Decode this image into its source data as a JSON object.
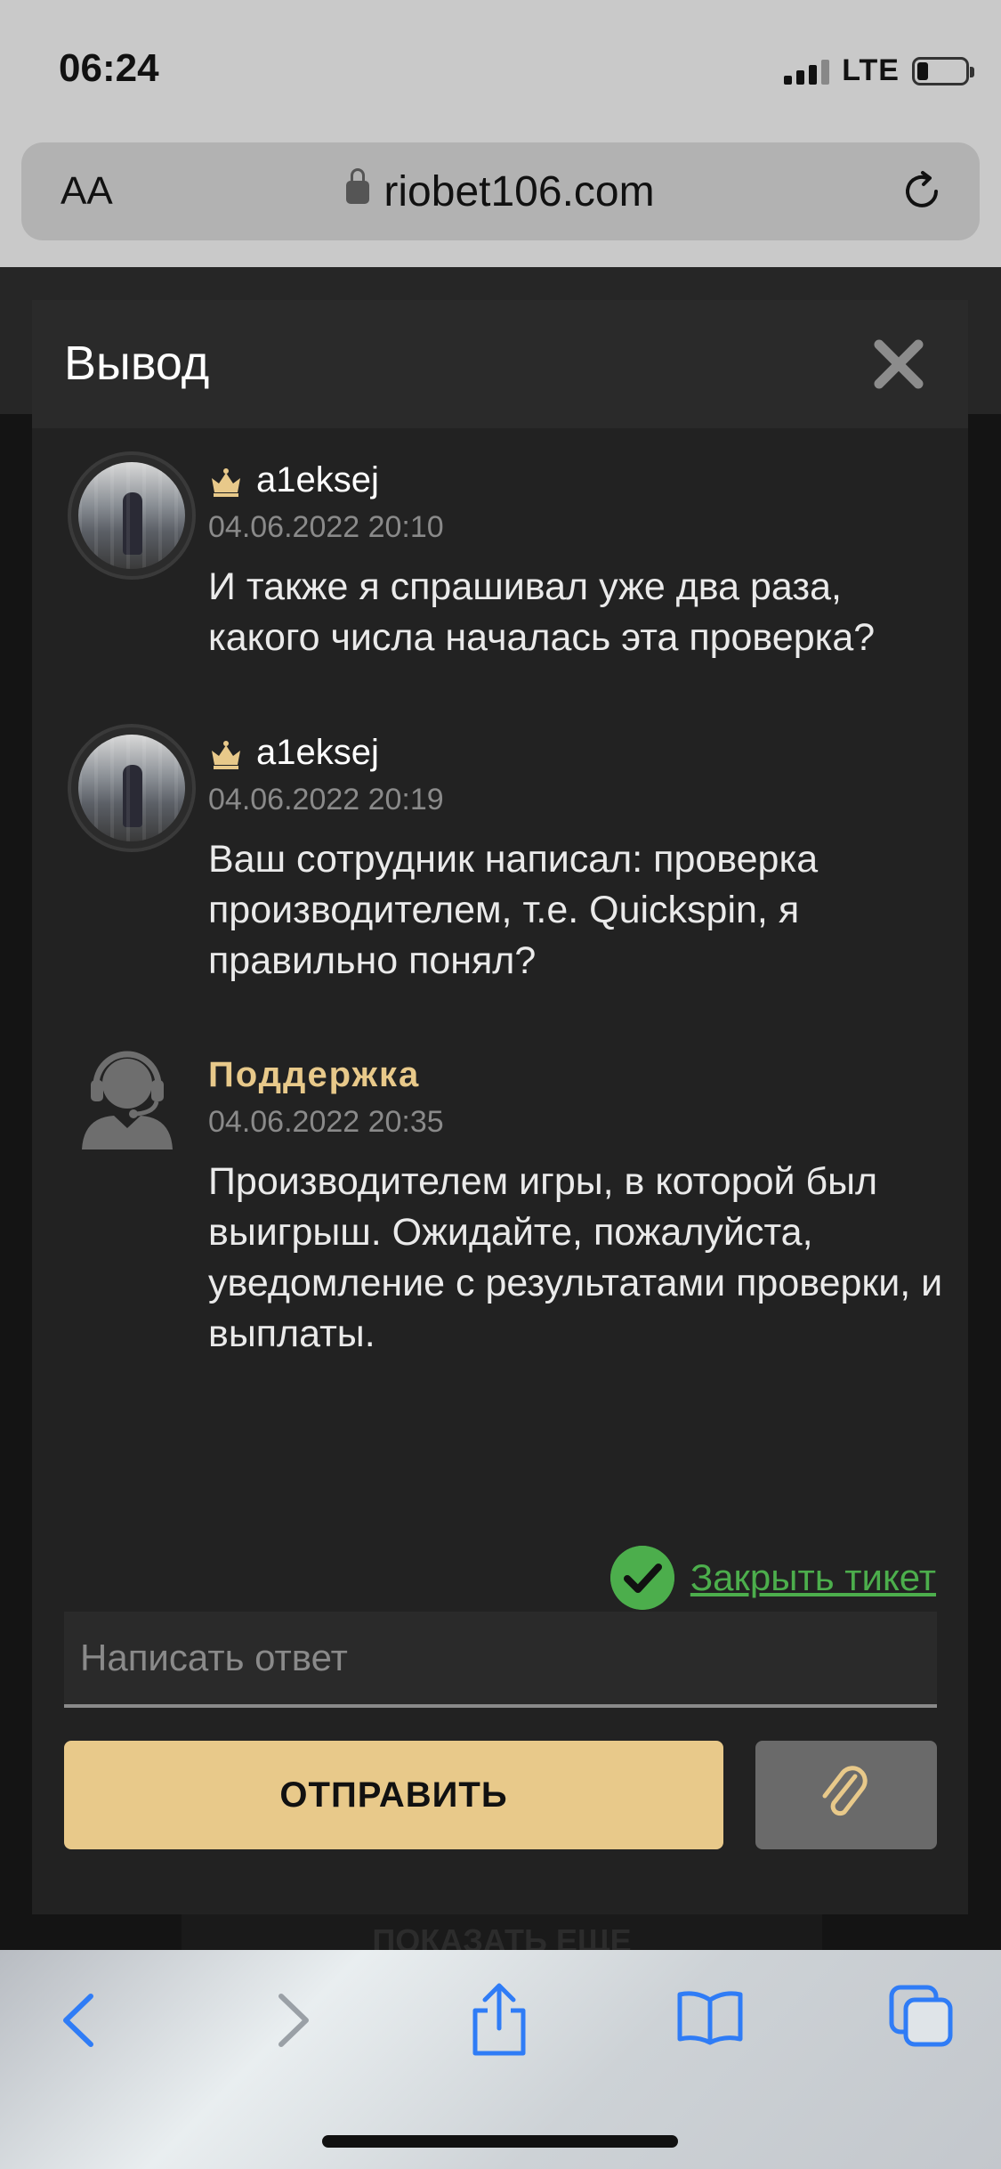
{
  "status_bar": {
    "time": "06:24",
    "network": "LTE"
  },
  "browser": {
    "text_size_label": "AA",
    "url": "riobet106.com"
  },
  "modal": {
    "title": "Вывод",
    "messages": [
      {
        "author": "a1eksej",
        "time": "04.06.2022 20:10",
        "text": "И также я спрашивал уже два раза, какого числа началась эта проверка?"
      },
      {
        "author": "a1eksej",
        "time": "04.06.2022 20:19",
        "text": "Ваш сотрудник написал: проверка производителем, т.е. Quickspin, я правильно понял?"
      },
      {
        "author": "Поддержка",
        "time": "04.06.2022 20:35",
        "text": "Производителем игры, в которой был выигрыш. Ожидайте, пожалуйста, уведомление с результатами проверки, и выплаты."
      }
    ],
    "close_ticket_label": "Закрыть тикет",
    "reply_placeholder": "Написать ответ",
    "send_label": "ОТПРАВИТЬ"
  },
  "background": {
    "show_more_label": "ПОКАЗАТЬ ЕЩЕ"
  },
  "colors": {
    "accent": "#e8c98a",
    "success": "#4cae4c",
    "ios_blue": "#2f7cf6"
  }
}
